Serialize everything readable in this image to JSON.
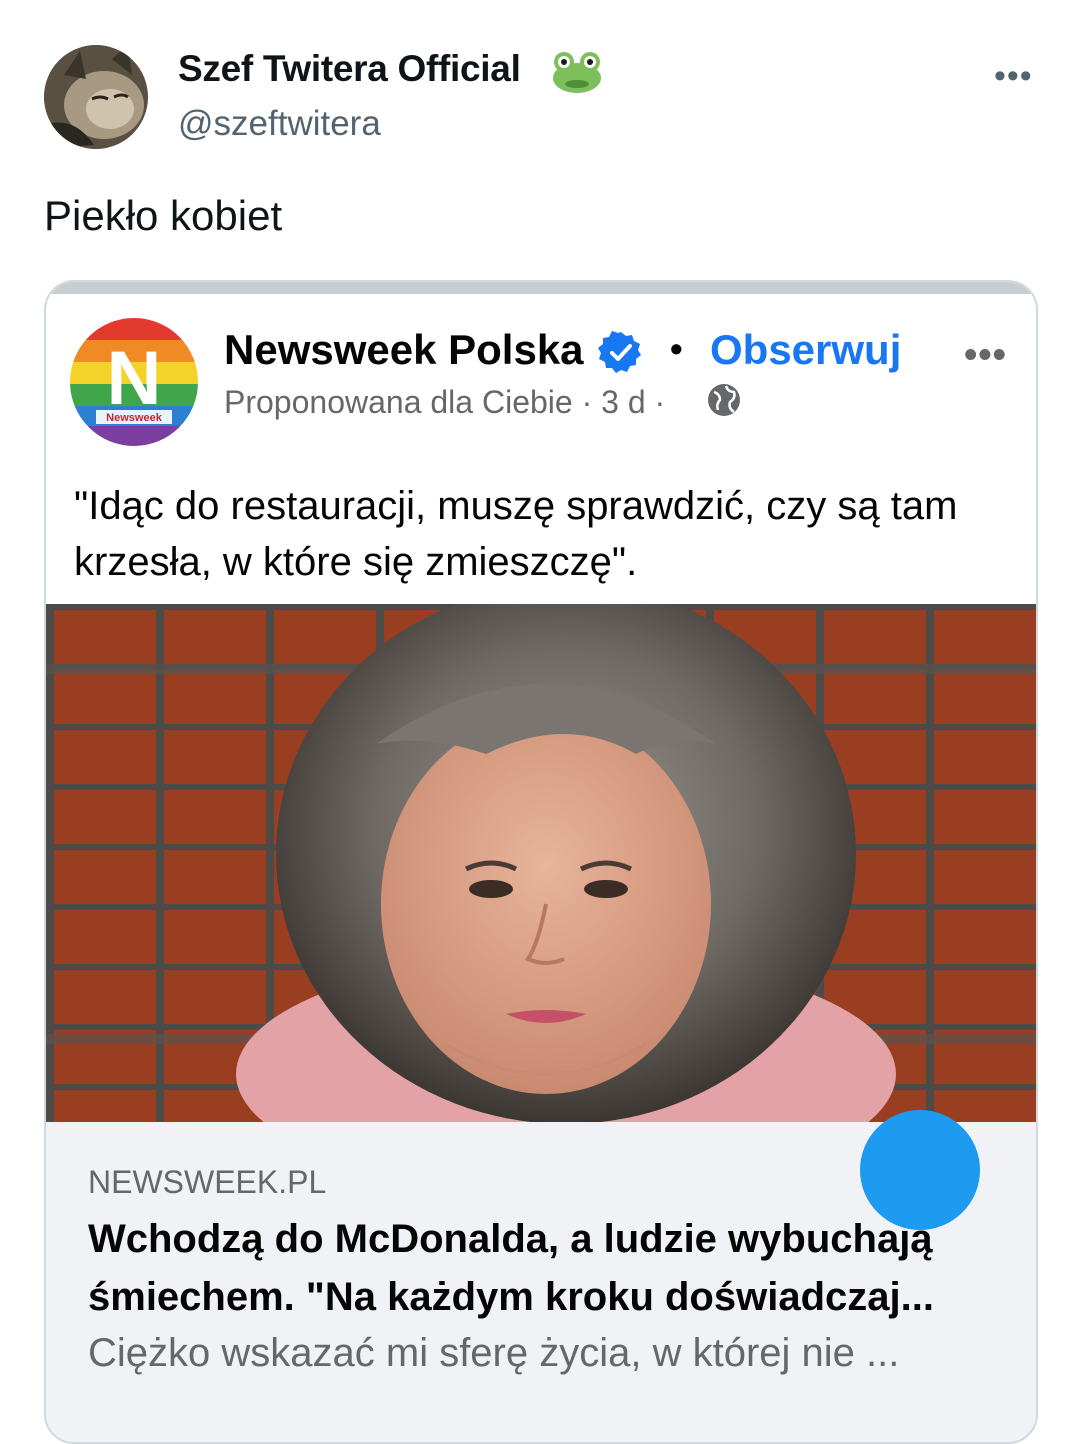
{
  "tweet": {
    "author_name": "Szef Twitera Official",
    "author_handle": "@szeftwitera",
    "more_label": "•••",
    "text": "Piekło kobiet",
    "name_emoji_icon": "frog-face-icon"
  },
  "embedded_post": {
    "page_name": "Newsweek Polska",
    "logo_text": "Newsweek",
    "logo_letter": "N",
    "separator": "•",
    "follow_label": "Obserwuj",
    "more_label": "•••",
    "meta": "Proponowana dla Ciebie · 3 d ·",
    "text": "\"Idąc do restauracji, muszę sprawdzić, czy są tam krzesła, w które się zmieszczę\".",
    "link": {
      "domain": "NEWSWEEK.PL",
      "title": "Wchodzą do McDonalda, a ludzie wybuchają śmiechem. \"Na każdym kroku doświadczaj...",
      "description": "Ciężko wskazać mi sferę życia, w której nie ..."
    }
  },
  "colors": {
    "accent_blue": "#1877f2",
    "twitter_blue": "#1d9bf0",
    "muted_text": "#536471"
  }
}
